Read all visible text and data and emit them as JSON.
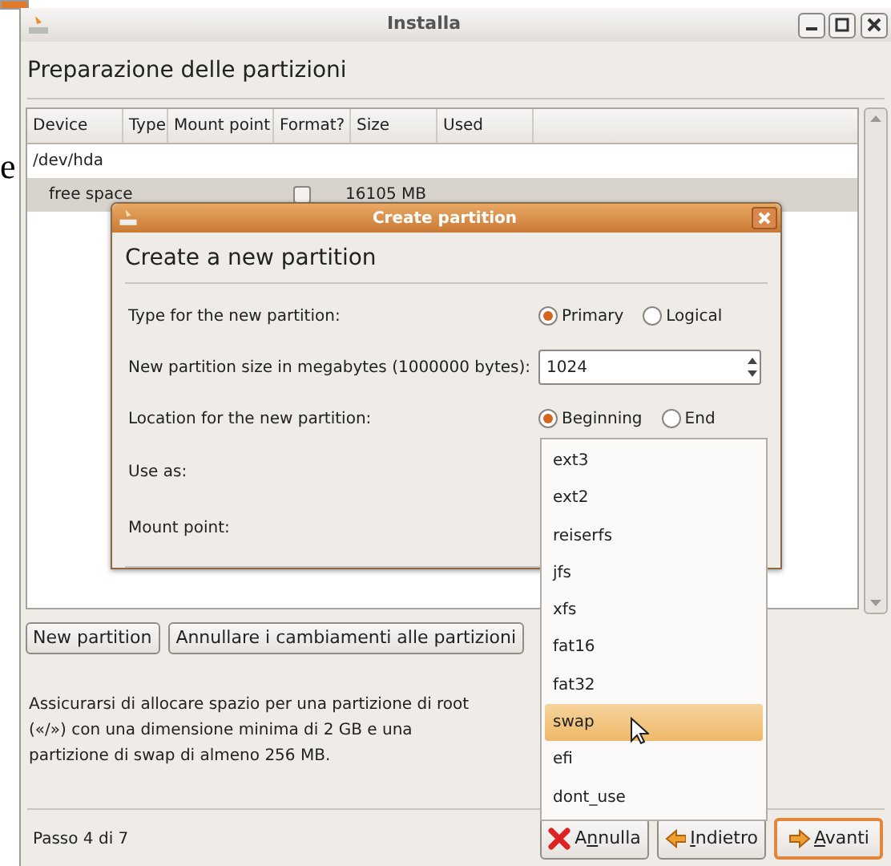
{
  "background_text": "e",
  "window": {
    "title": "Installa"
  },
  "heading": "Preparazione delle partizioni",
  "table": {
    "columns": [
      "Device",
      "Type",
      "Mount point",
      "Format?",
      "Size",
      "Used"
    ],
    "rows": [
      {
        "kind": "disk",
        "device": "/dev/hda",
        "selected": false
      },
      {
        "kind": "partition",
        "device": "free space",
        "format": false,
        "size": "16105 MB",
        "selected": true
      }
    ]
  },
  "table_buttons": [
    "New partition",
    "Annullare i cambiamenti alle partizioni"
  ],
  "note": "Assicurarsi di allocare spazio per una partizione di root («/») con una dimensione minima di 2 GB e una partizione di swap di almeno 256 MB.",
  "step": "Passo 4 di 7",
  "nav_buttons": [
    {
      "kind": "cancel",
      "before_key": "A",
      "access_key": "n",
      "after_key": "nulla",
      "default": false
    },
    {
      "kind": "back",
      "access_key": "I",
      "after_key": "ndietro",
      "default": false
    },
    {
      "kind": "forward",
      "access_key": "A",
      "after_key": "vanti",
      "default": true
    }
  ],
  "dialog": {
    "title": "Create partition",
    "heading": "Create a new partition",
    "fields": [
      {
        "kind": "radio",
        "label": "Type for the new partition:",
        "options": [
          {
            "label": "Primary",
            "selected": true
          },
          {
            "label": "Logical",
            "selected": false
          }
        ]
      },
      {
        "kind": "spin",
        "label": "New partition size in megabytes (1000000 bytes):",
        "value": "1024"
      },
      {
        "kind": "radio",
        "label": "Location for the new partition:",
        "options": [
          {
            "label": "Beginning",
            "selected": true
          },
          {
            "label": "End",
            "selected": false
          }
        ]
      },
      {
        "kind": "combo",
        "label": "Use as:"
      },
      {
        "kind": "entry",
        "label": "Mount point:"
      }
    ]
  },
  "dropdown": {
    "items": [
      {
        "label": "ext3",
        "selected": false
      },
      {
        "label": "ext2",
        "selected": false
      },
      {
        "label": "reiserfs",
        "selected": false
      },
      {
        "label": "jfs",
        "selected": false
      },
      {
        "label": "xfs",
        "selected": false
      },
      {
        "label": "fat16",
        "selected": false
      },
      {
        "label": "fat32",
        "selected": false
      },
      {
        "label": "swap",
        "selected": true
      },
      {
        "label": "efi",
        "selected": false
      },
      {
        "label": "dont_use",
        "selected": false
      }
    ]
  }
}
